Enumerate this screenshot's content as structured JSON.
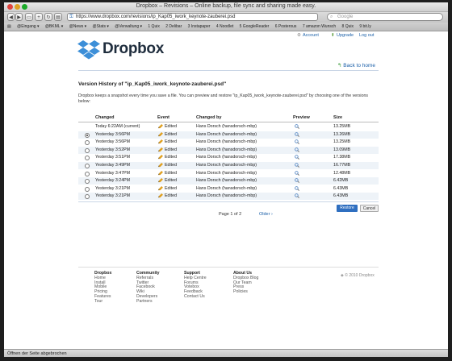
{
  "window": {
    "title": "Dropbox – Revisions – Online backup, file sync and sharing made easy.",
    "url": "https://www.dropbox.com/revisions/ip_Kap05_iwork_keynote-zauberei.psd",
    "search_placeholder": "Google",
    "status": "Öffnen der Seite abgebrochen"
  },
  "bookmarks": [
    "@Eingang ▾",
    "@BKML ▾",
    "@News ▾",
    "@Stats ▾",
    "@Verwaltung ▾",
    "1 Quix",
    "2 Delibar",
    "3 Instapaper",
    "4 Noodlet",
    "5 GoogleReader",
    "6 Posterous",
    "7 amazon Wunsch",
    "8 Quix",
    "9 bit.ly"
  ],
  "header": {
    "brand": "Dropbox",
    "links": {
      "account": "Account",
      "upgrade": "Upgrade",
      "logout": "Log out"
    },
    "back": "Back to home"
  },
  "main": {
    "title": "Version History of \"ip_Kap05_iwork_keynote-zauberei.psd\"",
    "description": "Dropbox keeps a snapshot every time you save a file. You can preview and restore \"ip_Kap05_iwork_keynote-zauberei.psd\" by choosing one of the versions below:",
    "columns": {
      "changed": "Changed",
      "event": "Event",
      "changed_by": "Changed by",
      "preview": "Preview",
      "size": "Size"
    },
    "rows": [
      {
        "changed": "Today 6:22AM (current)",
        "event": "Edited",
        "by": "Hans Dorsch (hansdorsch-mbp)",
        "size": "13.25MB",
        "radio": false
      },
      {
        "changed": "Yesterday 3:56PM",
        "event": "Edited",
        "by": "Hans Dorsch (hansdorsch-mbp)",
        "size": "13.26MB",
        "radio": true,
        "selected": true
      },
      {
        "changed": "Yesterday 3:56PM",
        "event": "Edited",
        "by": "Hans Dorsch (hansdorsch-mbp)",
        "size": "13.25MB",
        "radio": true
      },
      {
        "changed": "Yesterday 3:52PM",
        "event": "Edited",
        "by": "Hans Dorsch (hansdorsch-mbp)",
        "size": "13.09MB",
        "radio": true
      },
      {
        "changed": "Yesterday 3:51PM",
        "event": "Edited",
        "by": "Hans Dorsch (hansdorsch-mbp)",
        "size": "17.38MB",
        "radio": true
      },
      {
        "changed": "Yesterday 3:49PM",
        "event": "Edited",
        "by": "Hans Dorsch (hansdorsch-mbp)",
        "size": "16.77MB",
        "radio": true
      },
      {
        "changed": "Yesterday 3:47PM",
        "event": "Edited",
        "by": "Hans Dorsch (hansdorsch-mbp)",
        "size": "12.48MB",
        "radio": true
      },
      {
        "changed": "Yesterday 3:24PM",
        "event": "Edited",
        "by": "Hans Dorsch (hansdorsch-mbp)",
        "size": "6.42MB",
        "radio": true
      },
      {
        "changed": "Yesterday 3:21PM",
        "event": "Edited",
        "by": "Hans Dorsch (hansdorsch-mbp)",
        "size": "6.43MB",
        "radio": true
      },
      {
        "changed": "Yesterday 3:21PM",
        "event": "Edited",
        "by": "Hans Dorsch (hansdorsch-mbp)",
        "size": "6.43MB",
        "radio": true
      }
    ],
    "restore": "Restore",
    "cancel": "Cancel",
    "page_of": "Page 1 of 2",
    "older": "Older ›"
  },
  "footer": {
    "dropbox": {
      "heading": "Dropbox",
      "items": [
        "Home",
        "Install",
        "Mobile",
        "Pricing",
        "Features",
        "Tour"
      ]
    },
    "community": {
      "heading": "Community",
      "items": [
        "Referrals",
        "Twitter",
        "Facebook",
        "Wiki",
        "Developers",
        "Partners"
      ]
    },
    "support": {
      "heading": "Support",
      "items": [
        "Help Centre",
        "Forums",
        "Votebox",
        "Feedback",
        "Contact Us"
      ]
    },
    "about": {
      "heading": "About Us",
      "items": [
        "Dropbox Blog",
        "Our Team",
        "Press",
        "Policies"
      ]
    },
    "copyright": "© 2010 Dropbox"
  },
  "colors": {
    "accent": "#1a5fa8",
    "restore_button": "#2f6fc0",
    "logo_blue": "#3d8fd8"
  }
}
